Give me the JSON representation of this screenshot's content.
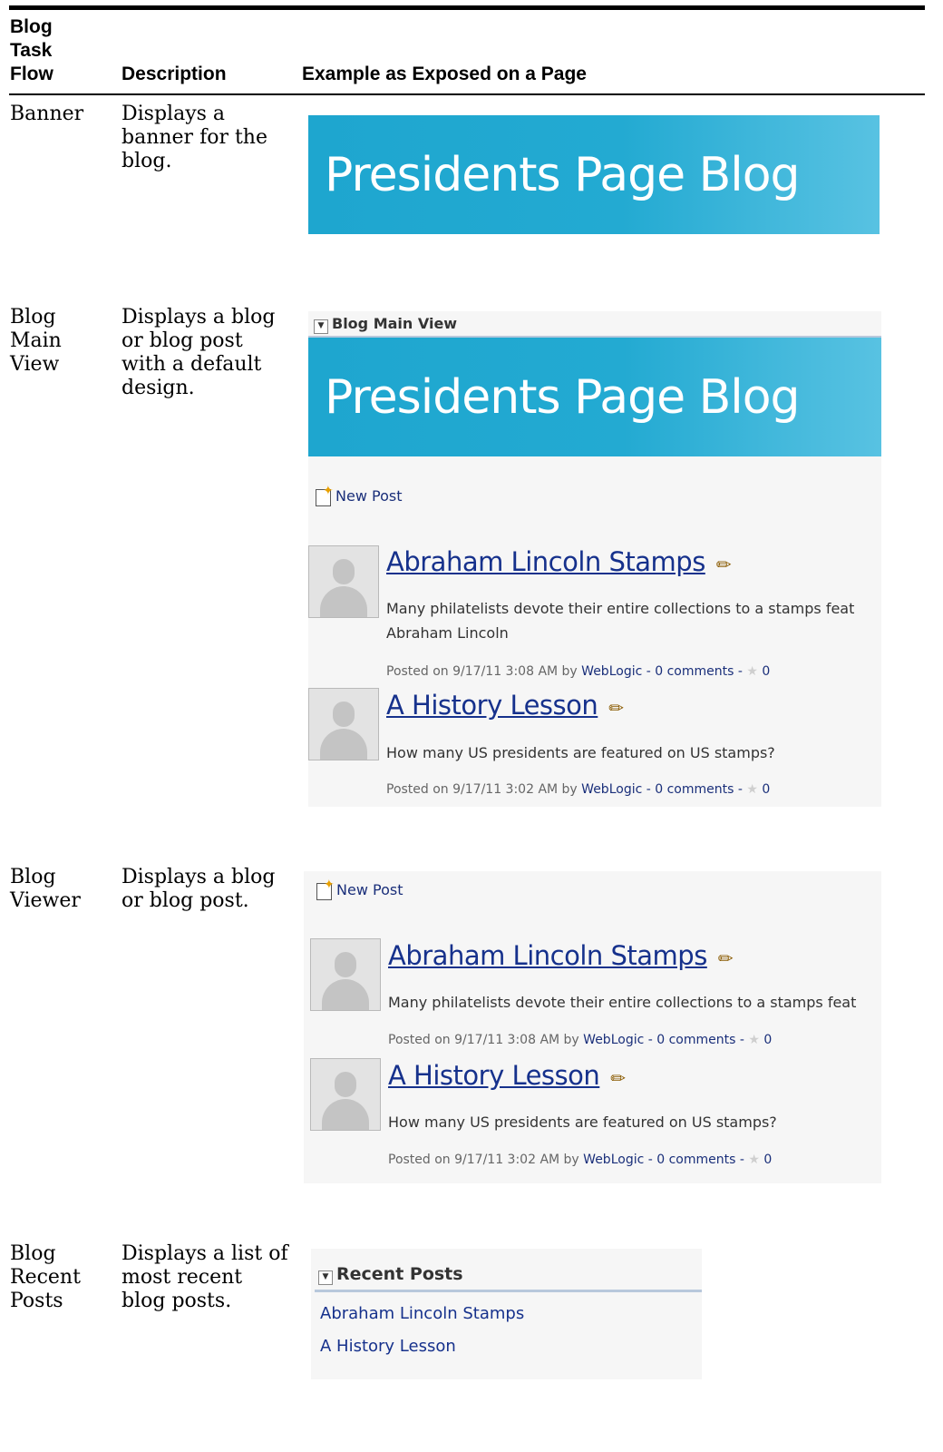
{
  "table": {
    "headers": {
      "flow": "Blog Task Flow",
      "description": "Description",
      "example": "Example as Exposed on a Page"
    },
    "rows": [
      {
        "name": "Banner",
        "description": "Displays a banner for the blog."
      },
      {
        "name": "Blog Main View",
        "description": "Displays a blog or blog post with a default design."
      },
      {
        "name": "Blog Viewer",
        "description": "Displays a blog or blog post."
      },
      {
        "name": "Blog Recent Posts",
        "description": "Displays a list of most recent blog posts."
      }
    ]
  },
  "banner": {
    "title": "Presidents Page Blog"
  },
  "main_view": {
    "panel_title": "Blog Main View"
  },
  "new_post_label": "New Post",
  "posts": [
    {
      "title": "Abraham Lincoln Stamps",
      "body_line1": "Many philatelists devote their entire collections to a stamps feat",
      "body_line2": "Abraham Lincoln",
      "posted": "Posted on 9/17/11 3:08 AM by",
      "author": "WebLogic",
      "comments": "- 0 comments -",
      "rating": "0"
    },
    {
      "title": "A History Lesson",
      "body_line1": "How many US presidents are featured on US stamps?",
      "posted": "Posted on 9/17/11 3:02 AM by",
      "author": "WebLogic",
      "comments": "- 0 comments -",
      "rating": "0"
    }
  ],
  "recent_posts": {
    "panel_title": "Recent Posts",
    "items": [
      "Abraham Lincoln Stamps",
      "A History Lesson"
    ]
  },
  "colors": {
    "banner": "#23aad2",
    "link": "#16318c"
  },
  "icons": [
    "chevron-down-icon",
    "new-post-icon",
    "pencil-icon",
    "star-icon",
    "avatar-placeholder"
  ]
}
